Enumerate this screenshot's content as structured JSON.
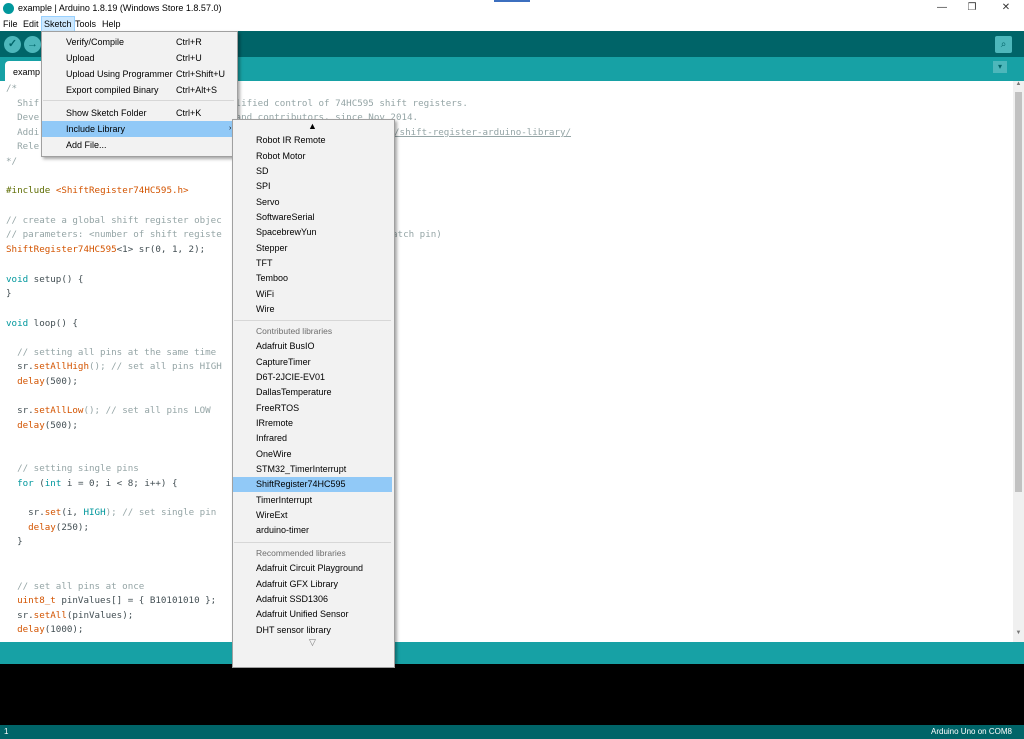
{
  "window": {
    "title": "example | Arduino 1.8.19 (Windows Store 1.8.57.0)",
    "minimize": "—",
    "maximize": "❐",
    "close": "✕"
  },
  "menubar": {
    "file": "File",
    "edit": "Edit",
    "sketch": "Sketch",
    "tools": "Tools",
    "help": "Help"
  },
  "toolbar": {
    "verify_icon": "✓",
    "upload_icon": "→",
    "serial_icon": "⌕"
  },
  "tab": {
    "name": "examp",
    "menu_icon": "▾"
  },
  "sketch_menu": {
    "items": [
      {
        "label": "Verify/Compile",
        "shortcut": "Ctrl+R"
      },
      {
        "label": "Upload",
        "shortcut": "Ctrl+U"
      },
      {
        "label": "Upload Using Programmer",
        "shortcut": "Ctrl+Shift+U"
      },
      {
        "label": "Export compiled Binary",
        "shortcut": "Ctrl+Alt+S"
      },
      {
        "label": "Show Sketch Folder",
        "shortcut": "Ctrl+K"
      },
      {
        "label": "Include Library",
        "shortcut": ""
      },
      {
        "label": "Add File...",
        "shortcut": ""
      }
    ],
    "submenu_arrow": "›"
  },
  "library_menu": {
    "scroll_up": "▲",
    "scroll_down": "▽",
    "builtin": [
      "Robot IR Remote",
      "Robot Motor",
      "SD",
      "SPI",
      "Servo",
      "SoftwareSerial",
      "SpacebrewYun",
      "Stepper",
      "TFT",
      "Temboo",
      "WiFi",
      "Wire"
    ],
    "contributed_header": "Contributed libraries",
    "contributed": [
      "Adafruit BusIO",
      "CaptureTimer",
      "D6T-2JCIE-EV01",
      "DallasTemperature",
      "FreeRTOS",
      "IRremote",
      "Infrared",
      "OneWire",
      "STM32_TimerInterrupt",
      "ShiftRegister74HC595",
      "TimerInterrupt",
      "WireExt",
      "arduino-timer"
    ],
    "recommended_header": "Recommended libraries",
    "recommended": [
      "Adafruit Circuit Playground",
      "Adafruit GFX Library",
      "Adafruit SSD1306",
      "Adafruit Unified Sensor",
      "DHT sensor library"
    ]
  },
  "code": {
    "l1": "/*",
    "l2_a": "  Shif",
    "l2_b": "plified control of 74HC595 shift registers.",
    "l3_a": "  Deve",
    "l3_b": " and contributors, since Nov 2014.",
    "l4_a": "  Addi",
    "l4_b": "/shift-register-arduino-library/",
    "l5": "  Rele",
    "l6": "*/",
    "inc_kw": "#include",
    "inc_lib": "<ShiftRegister74HC595.h>",
    "c1": "// create a global shift register objec",
    "c2_a": "// parameters: <number of shift registe",
    "c2_b": "atch pin)",
    "decl_type": "ShiftRegister74HC595",
    "decl_rest": "<1> sr(0, 1, 2);",
    "setup_kw": "void",
    "setup_rest": " setup() {",
    "close": "}",
    "loop_kw": "void",
    "loop_rest": " loop() {",
    "c3": "  // setting all pins at the same time",
    "s1_a": "  sr.",
    "s1_fn": "setAllHigh",
    "s1_b": "(); // set all pins HIGH",
    "d1_fn": "  delay",
    "d1_b": "(500);",
    "s2_a": "  sr.",
    "s2_fn": "setAllLow",
    "s2_b": "(); // set all pins LOW",
    "d2_fn": "  delay",
    "d2_b": "(500);",
    "c4": "  // setting single pins",
    "for_kw": "  for",
    "for_a": " (",
    "for_int": "int",
    "for_b": " i = 0; i < 8; i++) {",
    "set_a": "    sr.",
    "set_fn": "set",
    "set_b": "(i, ",
    "set_c": "HIGH",
    "set_d": "); // set single pin",
    "d3_fn": "    delay",
    "d3_b": "(250);",
    "close2": "  }",
    "c5": "  // set all pins at once",
    "u_type": "  uint8_t",
    "u_rest": " pinValues[] = { B10101010 };",
    "sa_a": "  sr.",
    "sa_fn": "setAll",
    "sa_b": "(pinValues);",
    "d4_fn": "  delay",
    "d4_b": "(1000);"
  },
  "status": {
    "line": "1",
    "board": "Arduino Uno on COM8"
  }
}
